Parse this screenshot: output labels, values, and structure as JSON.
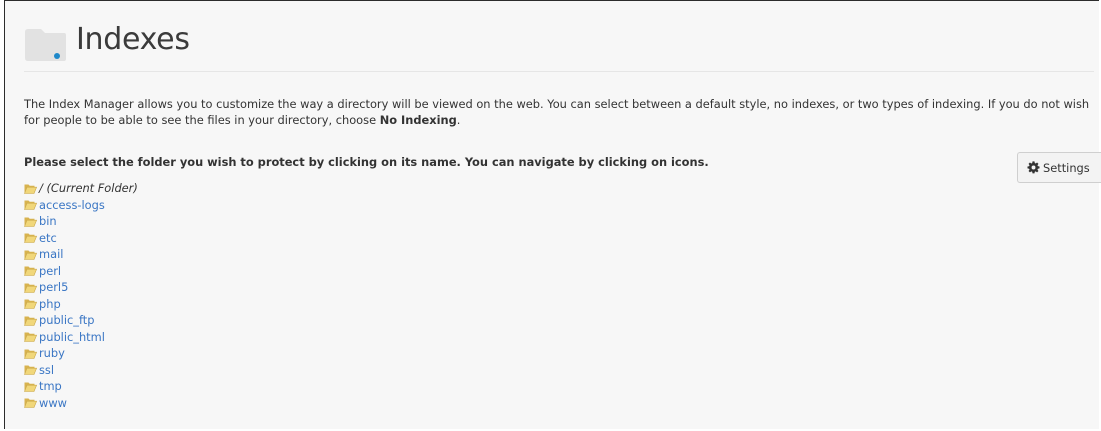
{
  "page": {
    "title": "Indexes",
    "description_text": "The Index Manager allows you to customize the way a directory will be viewed on the web. You can select between a default style, no indexes, or two types of indexing. If you do not wish for people to be able to see the files in your directory, choose ",
    "description_bold": "No Indexing",
    "description_end": ".",
    "instruction": "Please select the folder you wish to protect by clicking on its name. You can navigate by clicking on icons."
  },
  "settings": {
    "label": "Settings",
    "icon": "gear-icon"
  },
  "folders": {
    "current": "/ (Current Folder)",
    "items": [
      "access-logs",
      "bin",
      "etc",
      "mail",
      "perl",
      "perl5",
      "php",
      "public_ftp",
      "public_html",
      "ruby",
      "ssl",
      "tmp",
      "www"
    ]
  },
  "colors": {
    "link": "#3a76c4",
    "folder_icon": "#e7c86a",
    "header_icon": "#e3e3e3",
    "header_dot": "#1e88c9"
  }
}
